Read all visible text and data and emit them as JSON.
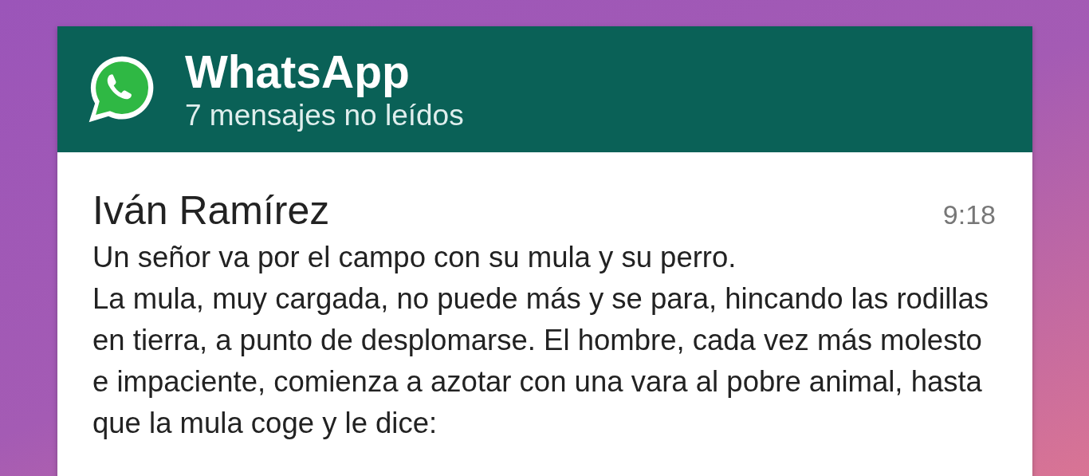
{
  "notification": {
    "app_name": "WhatsApp",
    "summary": "7 mensajes no leídos"
  },
  "messages": [
    {
      "sender": "Iván Ramírez",
      "time": "9:18",
      "paragraphs": [
        "Un señor va por el campo con su mula y su perro.",
        "La mula, muy cargada, no puede más y se para, hincando las rodillas en tierra, a punto de desplomarse. El hombre, cada vez más molesto e impaciente, comienza a azotar con una vara al pobre animal, hasta que la mula coge y le dice:"
      ]
    }
  ]
}
